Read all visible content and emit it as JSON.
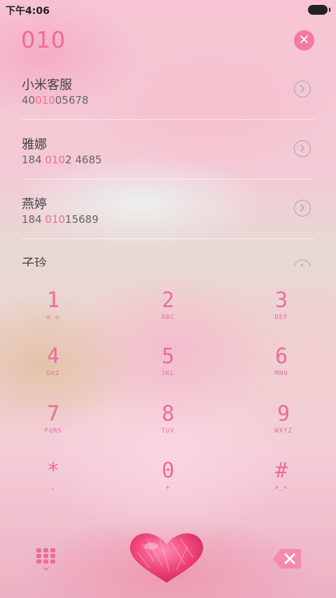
{
  "status_bar": {
    "time": "下午4:06",
    "icons": [
      "battery-icon"
    ]
  },
  "dialer": {
    "number": "010",
    "clear_icon": "close-icon",
    "clear_symbol": "✕"
  },
  "contacts": [
    {
      "name": "小米客服",
      "number_parts": [
        "40",
        "010",
        "05678"
      ]
    },
    {
      "name": "雅娜",
      "number_parts": [
        "184 ",
        "010",
        "2 4685"
      ]
    },
    {
      "name": "燕婷",
      "number_parts": [
        "184 ",
        "010",
        "15689"
      ]
    },
    {
      "name": "子玲",
      "number_parts": [
        "",
        "",
        ""
      ]
    }
  ],
  "keypad": [
    {
      "digit": "1",
      "letters": "◎_◎"
    },
    {
      "digit": "2",
      "letters": "ABC"
    },
    {
      "digit": "3",
      "letters": "DEF"
    },
    {
      "digit": "4",
      "letters": "GHI"
    },
    {
      "digit": "5",
      "letters": "JKL"
    },
    {
      "digit": "6",
      "letters": "MNO"
    },
    {
      "digit": "7",
      "letters": "PQRS"
    },
    {
      "digit": "8",
      "letters": "TUV"
    },
    {
      "digit": "9",
      "letters": "WXYZ"
    },
    {
      "digit": "*",
      "letters": ","
    },
    {
      "digit": "0",
      "letters": "+"
    },
    {
      "digit": "#",
      "letters": ">_<"
    }
  ],
  "bottom_bar": {
    "left_icon": "keypad-grid-icon",
    "center_icon": "heart-call-icon",
    "right_icon": "backspace-icon"
  },
  "colors": {
    "accent": "#ee6aa0",
    "highlight": "#ef6f8f",
    "clear_bg": "#f27aa3",
    "heart": "#f0457a"
  }
}
